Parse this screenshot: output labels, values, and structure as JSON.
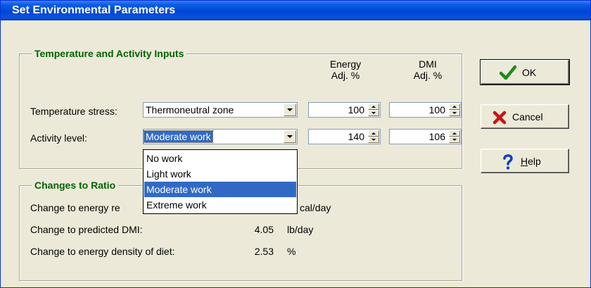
{
  "window": {
    "title": "Set Environmental Parameters"
  },
  "inputs_group": {
    "title": "Temperature and Activity Inputs",
    "energy_header": [
      "Energy",
      "Adj. %"
    ],
    "dmi_header": [
      "DMI",
      "Adj. %"
    ],
    "temperature": {
      "label": "Temperature stress:",
      "value": "Thermoneutral zone",
      "energy": "100",
      "dmi": "100"
    },
    "activity": {
      "label": "Activity level:",
      "value": "Moderate work",
      "energy": "140",
      "dmi": "106"
    }
  },
  "dropdown": {
    "options": [
      "No work",
      "Light work",
      "Moderate work",
      "Extreme work"
    ],
    "selected": "Moderate work"
  },
  "changes_group": {
    "title": "Changes to Ratio",
    "rows": [
      {
        "label": "Change to energy re",
        "value": "",
        "unit": "cal/day"
      },
      {
        "label": "Change to predicted DMI:",
        "value": "4.05",
        "unit": "lb/day"
      },
      {
        "label": "Change to energy density of diet:",
        "value": "2.53",
        "unit": "%"
      }
    ]
  },
  "buttons": {
    "ok": "OK",
    "cancel": "Cancel",
    "help": "Help",
    "help_mnemonic": "H",
    "help_rest": "elp"
  },
  "colors": {
    "group_title": "#006400",
    "selection": "#316ac5",
    "titlebar": "#0046d5"
  },
  "icons": {
    "ok": "checkmark-icon",
    "cancel": "red-x-icon",
    "help": "question-mark-icon"
  }
}
